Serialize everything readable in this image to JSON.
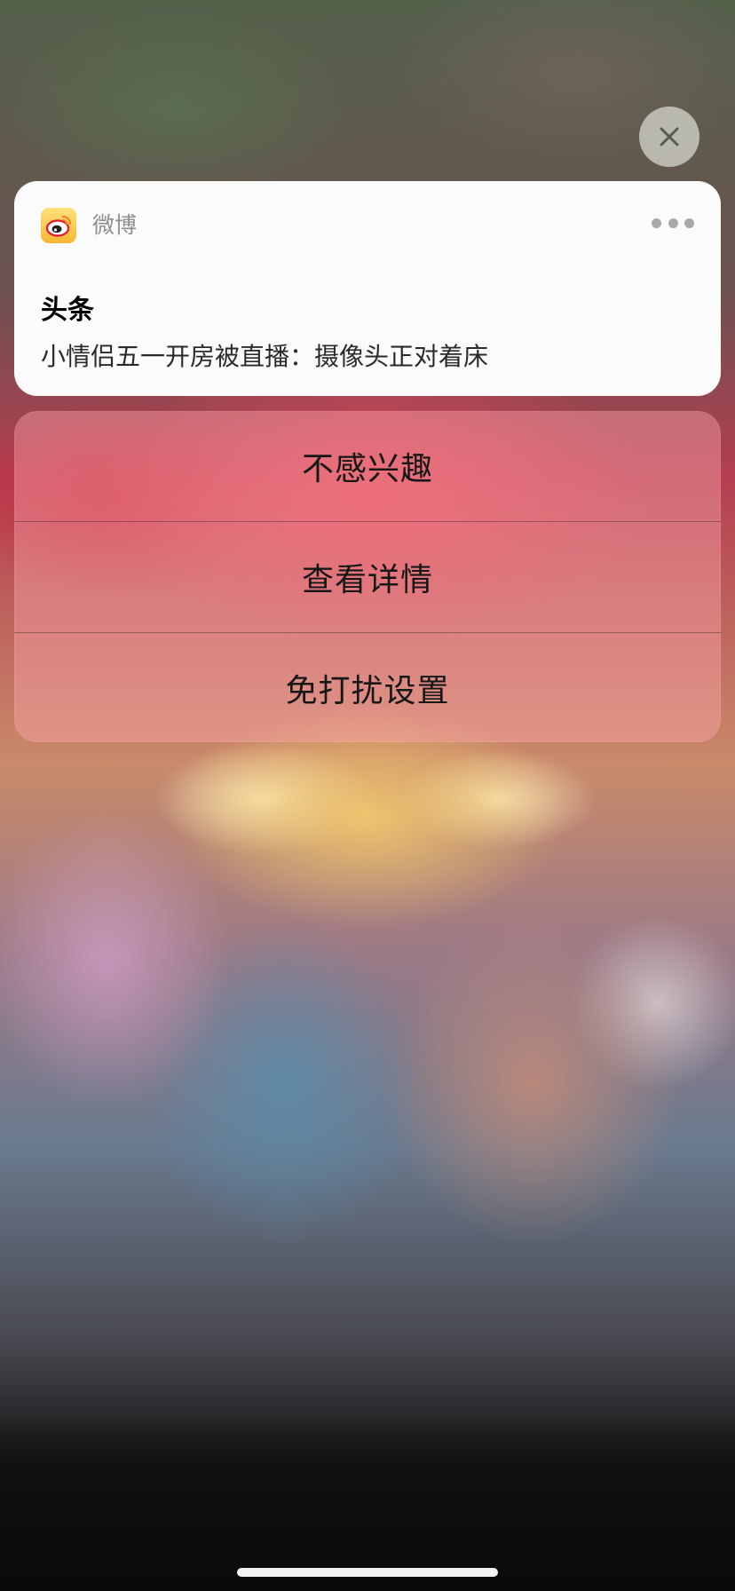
{
  "notification": {
    "app_name": "微博",
    "title": "头条",
    "body": "小情侣五一开房被直播：摄像头正对着床",
    "app_icon": "weibo-logo-icon",
    "more_icon": "ellipsis-icon"
  },
  "close_button": {
    "icon": "close-icon"
  },
  "actions": [
    {
      "label": "不感兴趣"
    },
    {
      "label": "查看详情"
    },
    {
      "label": "免打扰设置"
    }
  ],
  "colors": {
    "notification_background": "#fbfbfb",
    "app_name_gray": "#8e8e93",
    "weibo_icon_yellow": "#f7b733",
    "weibo_icon_red": "#e6162d"
  }
}
